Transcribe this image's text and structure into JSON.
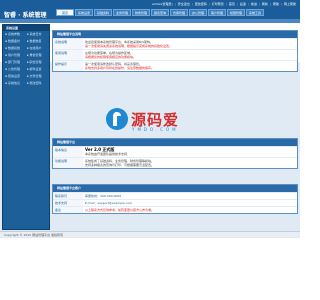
{
  "header": {
    "brand": "智睿 · 系统管理",
    "user_links": [
      "admin(管理员)",
      "安全退出",
      "更改密码",
      "打印预览",
      "首页",
      "后退",
      "前进",
      "刷新",
      "帮助",
      "网上帮助"
    ]
  },
  "nav": {
    "tabs": [
      "首页",
      "系统设置",
      "基础资料",
      "业务管理",
      "财务管理",
      "报表查询",
      "仓库管理",
      "办公管理",
      "客户管理",
      "权限管理",
      "系统工具"
    ]
  },
  "sidebar": {
    "title": "系统设置",
    "items": [
      "系统参数",
      "系统日志",
      "数据备份",
      "数据恢复",
      "数据初始",
      "在线用户",
      "用户管理",
      "角色管理",
      "部门管理",
      "职位管理",
      "公告管理",
      "邮件设置",
      "短信设置",
      "文件管理",
      "系统信息",
      "修改密码"
    ]
  },
  "panels": {
    "welcome": {
      "title": "网站管理平台说明",
      "rows": [
        {
          "label": "系统说明",
          "text": "欢迎您使用本系统管理平台，本系统采用B/S架构。",
          "note": "第一次使用请先阅读系统说明，根据提示完成系统的初始化设置。"
        },
        {
          "label": "使用说明",
          "text": "左侧为功能菜单，右侧为操作区域。",
          "note": "请根据您的权限使用相应的功能模块。"
        },
        {
          "label": "操作提示",
          "text": "第一次使用请修改默认密码，并妥善保管。",
          "note": "系统支持多用户同时在线操作，请注意数据的保存。"
        }
      ]
    },
    "version": {
      "title": "网站管理平台",
      "rows": [
        {
          "label": "版本信息",
          "text": "Ver 2.0 正式版",
          "note": "本系统由开发团队提供技术支持"
        },
        {
          "label": "功能说明",
          "text": "系统集成了基础资料、业务管理、财务管理等模块。",
          "note": "支持多种报表的查询与打印，可根据需要灵活配置。"
        }
      ]
    },
    "contact": {
      "title": "网站管理平台客户",
      "rows": [
        {
          "label": "联系我们",
          "text": "客服热线：400-000-0000",
          "note": ""
        },
        {
          "label": "技术支持",
          "text": "E-mail：support@example.com",
          "note": ""
        },
        {
          "label": "备注",
          "text": "以上联系方式仅供参考，如有变更以官方公布为准。",
          "note": ""
        }
      ]
    }
  },
  "watermark": {
    "text": "源码爱",
    "sub": "YMDO.COM"
  },
  "statusbar": {
    "text": "Copyright © 2015 网站管理平台 版权所有"
  },
  "colors": {
    "header": "#1a5d9a",
    "sidebar": "#1c5f99",
    "panel_head": "#2a6aa9",
    "background": "#dfeaf4"
  }
}
